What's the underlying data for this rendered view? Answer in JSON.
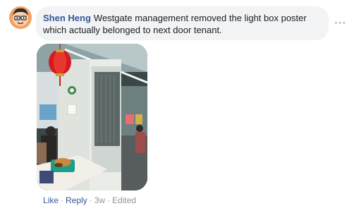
{
  "comment": {
    "author": "Shen Heng",
    "text": "Westgate management removed the light box poster which actually belonged to next door tenant.",
    "avatar_icon": "cartoon-face-avatar-icon",
    "more_icon": "ellipsis-icon",
    "more_label": "···"
  },
  "photo": {
    "icon": "photo-store-interior"
  },
  "actions": {
    "like": "Like",
    "sep": "·",
    "reply": "Reply",
    "time": "3w",
    "edited": "Edited"
  },
  "colors": {
    "link": "#385898",
    "bubble": "#f2f3f5",
    "meta": "#90949c"
  }
}
